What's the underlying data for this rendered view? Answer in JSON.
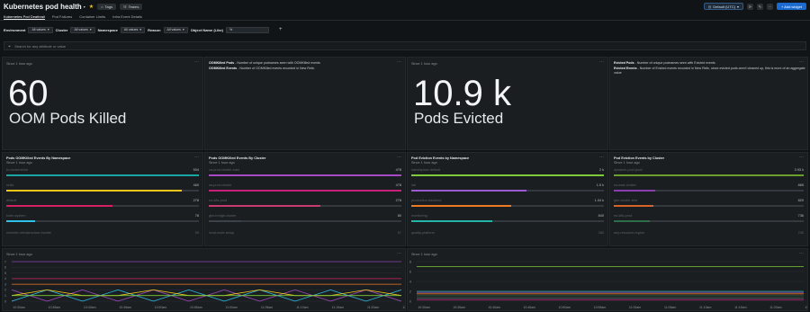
{
  "header": {
    "title": "Kubernetes pod health",
    "tags_label": "Tags",
    "teams_label": "Teams",
    "timezone_label": "Default (UTC)",
    "add_widget_label": "+ Add widget"
  },
  "tabs": [
    {
      "label": "Kubernetes Pod Deathrail",
      "active": true
    },
    {
      "label": "Pod Failures",
      "active": false
    },
    {
      "label": "Container Limits",
      "active": false
    },
    {
      "label": "Infra Event Details",
      "active": false
    }
  ],
  "filters": [
    {
      "label": "Environment",
      "value": "All values"
    },
    {
      "label": "Cluster",
      "value": "All values"
    },
    {
      "label": "Namespace",
      "value": "All values"
    },
    {
      "label": "Reason",
      "value": "All values"
    },
    {
      "label": "Object Name (Like)",
      "value": "%"
    }
  ],
  "search": {
    "placeholder": "Search for any attribute or value"
  },
  "since_label": "Since 1 hour ago",
  "oom_billboard": {
    "value": "60",
    "label": "OOM Pods Killed"
  },
  "oom_text": {
    "line1_bold": "OOMKilled Pods",
    "line1_rest": " - Number of unique podnames seen with OOMKilled events",
    "line2_bold": "OOMKilled Events",
    "line2_rest": " - Number of OOMKilled events recorded in New Relic"
  },
  "evicted_billboard": {
    "value": "10.9 k",
    "label": "Pods Evicted"
  },
  "evicted_text": {
    "line1_bold": "Evicted Pods",
    "line1_rest": " - Number of unique podnames seen with Evicted events",
    "line2_bold": "Evicted Events",
    "line2_rest": " - Number of Evicted events recorded in New Relic, since evicted pods aren't cleaned up, this is more of an aggregate value"
  },
  "bar_panels": [
    {
      "title": "Pods OOMKilled Events By Namespace",
      "subtitle": "Since 1 hour ago",
      "rows": [
        {
          "label": "kr-clusterstore",
          "value": "504",
          "fraction": 1.0,
          "color": "#1aa5a5"
        },
        {
          "label": "redis",
          "value": "460",
          "fraction": 0.91,
          "color": "#f2c51b"
        },
        {
          "label": "default",
          "value": "278",
          "fraction": 0.55,
          "color": "#d5215e"
        },
        {
          "label": "kube-system",
          "value": "78",
          "fraction": 0.15,
          "color": "#2ec1ea"
        }
      ],
      "footer_label": "newrelic-infrastructure-bundle",
      "footer_value": "59"
    },
    {
      "title": "Pods OOMKilled Events By Cluster",
      "subtitle": "Since 1 hour ago",
      "rows": [
        {
          "label": "ca-prod-cluster-east",
          "value": "478",
          "fraction": 1.0,
          "color": "#a64bc5"
        },
        {
          "label": "sa-prod-cluster",
          "value": "478",
          "fraction": 1.0,
          "color": "#c5207a"
        },
        {
          "label": "eu-k8s-prod",
          "value": "278",
          "fraction": 0.58,
          "color": "#c83b6e"
        },
        {
          "label": "gke-bridge-cluster",
          "value": "80",
          "fraction": 0.17,
          "color": "#3b424a"
        }
      ],
      "footer_label": "local-node-setup",
      "footer_value": "57"
    },
    {
      "title": "Pod Eviction Events by Namespace",
      "subtitle": "Since 1 hour ago",
      "rows": [
        {
          "label": "namespace-default",
          "value": "2 k",
          "fraction": 1.0,
          "color": "#7ecb3b"
        },
        {
          "label": "lab",
          "value": "1.5 k",
          "fraction": 0.6,
          "color": "#9b5bd0"
        },
        {
          "label": "production-backend",
          "value": "1.04 k",
          "fraction": 0.52,
          "color": "#ee7b22"
        },
        {
          "label": "monitoring",
          "value": "840",
          "fraction": 0.42,
          "color": "#23b5a5"
        }
      ],
      "footer_label": "quality-platform",
      "footer_value": "280"
    },
    {
      "title": "Pod Eviction Events by Cluster",
      "subtitle": "Since 1 hour ago",
      "rows": [
        {
          "label": "dynamic-pool-prod",
          "value": "3.93 k",
          "fraction": 1.0,
          "color": "#6c9f2f"
        },
        {
          "label": "us-east-cluster",
          "value": "865",
          "fraction": 0.22,
          "color": "#8a3fb0"
        },
        {
          "label": "gke-cluster-test",
          "value": "820",
          "fraction": 0.21,
          "color": "#d5642a"
        },
        {
          "label": "eu-k8s-prod",
          "value": "736",
          "fraction": 0.19,
          "color": "#2f6d4a"
        }
      ],
      "footer_label": "any-resource-region",
      "footer_value": "235"
    }
  ],
  "line_panels": [
    {
      "subtitle": "Since 1 hour ago",
      "y_ticks": [
        "7",
        "6",
        "5",
        "4",
        "3",
        "2",
        "1",
        "0"
      ],
      "x_ticks": [
        "10:30am",
        "10:35am",
        "10:40am",
        "10:45am",
        "10:50am",
        "10:55am",
        "11:00am",
        "11:05am",
        "11:10am",
        "11:15am",
        "11:20am",
        "11:25am"
      ]
    },
    {
      "subtitle": "Since 1 hour ago",
      "y_ticks": [
        "8",
        "6",
        "4",
        "2",
        "0"
      ],
      "x_ticks": [
        "10:30am",
        "10:35am",
        "10:40am",
        "10:45am",
        "10:50am",
        "10:55am",
        "11:00am",
        "11:05am",
        "11:10am",
        "11:15am",
        "11:20am",
        "11:25am"
      ]
    }
  ],
  "chart_data": [
    {
      "type": "line",
      "title": "",
      "ylim": [
        0,
        7
      ],
      "x": [
        "10:30am",
        "10:35am",
        "10:40am",
        "10:45am",
        "10:50am",
        "10:55am",
        "11:00am",
        "11:05am",
        "11:10am",
        "11:15am",
        "11:20am",
        "11:25am"
      ],
      "series": [
        {
          "color": "#8a3fb0",
          "values": [
            7,
            7,
            7,
            7,
            7,
            7,
            7,
            7,
            7,
            7,
            7,
            7
          ]
        },
        {
          "color": "#d5215e",
          "values": [
            4,
            4,
            4,
            4,
            4,
            4,
            4,
            4,
            4,
            4,
            4,
            4
          ]
        },
        {
          "color": "#ee7b22",
          "values": [
            3,
            3,
            3,
            3,
            3,
            3,
            3,
            3,
            3,
            3,
            3,
            3
          ]
        },
        {
          "color": "#2ec1ea",
          "values": [
            0,
            2,
            0,
            2,
            0,
            2,
            0,
            2,
            0,
            2,
            0,
            2
          ]
        },
        {
          "color": "#a64bc5",
          "values": [
            2,
            0,
            2,
            0,
            2,
            0,
            2,
            0,
            2,
            0,
            2,
            0
          ]
        },
        {
          "color": "#f2c51b",
          "values": [
            1,
            2,
            1,
            1,
            2,
            1,
            1,
            2,
            1,
            1,
            2,
            1
          ]
        },
        {
          "color": "#7ecb3b",
          "values": [
            1,
            1,
            1,
            1,
            1,
            1,
            1,
            1,
            1,
            1,
            1,
            1
          ]
        }
      ]
    },
    {
      "type": "line",
      "title": "",
      "ylim": [
        0,
        8
      ],
      "x": [
        "10:30am",
        "10:35am",
        "10:40am",
        "10:45am",
        "10:50am",
        "10:55am",
        "11:00am",
        "11:05am",
        "11:10am",
        "11:15am",
        "11:20am",
        "11:25am"
      ],
      "series": [
        {
          "color": "#7ecb3b",
          "values": [
            7,
            7,
            7,
            7,
            7,
            7,
            7,
            7,
            7,
            7,
            7,
            7
          ]
        },
        {
          "color": "#1aa5a5",
          "values": [
            2,
            2,
            2,
            2,
            2,
            2,
            2,
            2,
            2,
            2,
            2,
            2
          ]
        },
        {
          "color": "#9b5bd0",
          "values": [
            1.8,
            1.8,
            1.8,
            1.8,
            1.8,
            1.8,
            1.8,
            1.8,
            1.8,
            1.8,
            1.8,
            1.8
          ]
        },
        {
          "color": "#ee7b22",
          "values": [
            1.5,
            1.5,
            1.5,
            1.5,
            1.5,
            1.5,
            1.5,
            1.5,
            1.5,
            1.5,
            1.5,
            1.5
          ]
        },
        {
          "color": "#2f6d4a",
          "values": [
            1.1,
            1.1,
            1.1,
            1.1,
            1.1,
            1.1,
            1.1,
            1.1,
            1.1,
            1.1,
            1.1,
            1.1
          ]
        },
        {
          "color": "#5c6368",
          "values": [
            0.6,
            0.6,
            0.6,
            0.6,
            0.6,
            0.6,
            0.6,
            0.6,
            0.6,
            0.6,
            0.6,
            0.6
          ]
        },
        {
          "color": "#c5207a",
          "values": [
            0.3,
            0.3,
            0.3,
            0.3,
            0.3,
            0.3,
            0.3,
            0.3,
            0.3,
            0.3,
            0.3,
            0.3
          ]
        }
      ]
    }
  ]
}
